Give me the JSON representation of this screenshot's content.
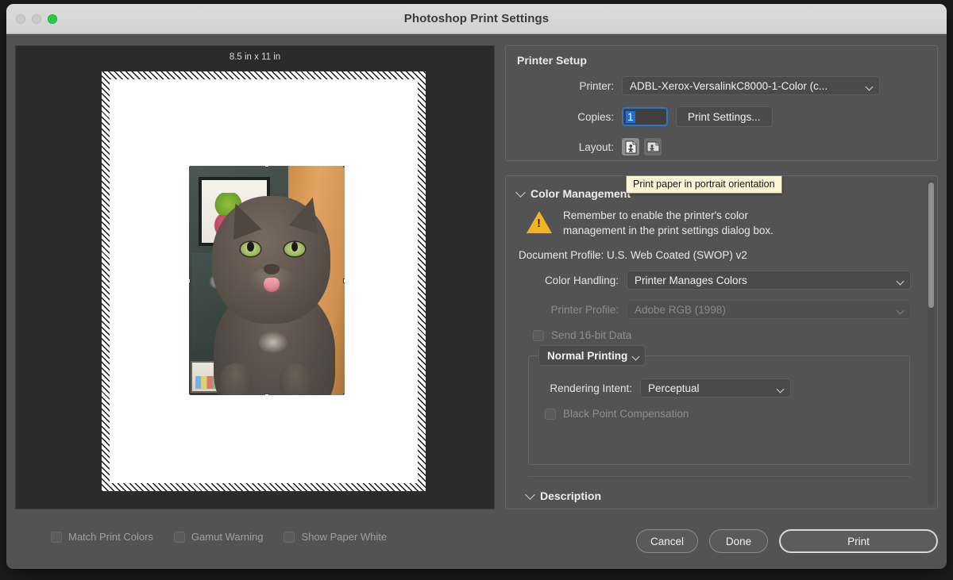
{
  "window": {
    "title": "Photoshop Print Settings",
    "traffic_lights": [
      "close",
      "minimize",
      "zoom"
    ]
  },
  "preview": {
    "page_size_label": "8.5 in x 11 in",
    "image_alt": "grey cat with tongue out",
    "proof_options": [
      {
        "label": "Match Print Colors",
        "checked": false,
        "enabled": false
      },
      {
        "label": "Gamut Warning",
        "checked": false,
        "enabled": false
      },
      {
        "label": "Show Paper White",
        "checked": false,
        "enabled": false
      }
    ]
  },
  "printer_setup": {
    "title": "Printer Setup",
    "printer_label": "Printer:",
    "printer_value": "ADBL-Xerox-VersalinkC8000-1-Color (c...",
    "copies_label": "Copies:",
    "copies_value": "1",
    "print_settings_label": "Print Settings...",
    "layout_label": "Layout:",
    "layout_portrait_selected": true
  },
  "tooltip": {
    "text": "Print paper in portrait orientation"
  },
  "color_management": {
    "title": "Color Management",
    "warning_text": "Remember to enable the printer's color management in the print settings dialog box.",
    "document_profile": "Document Profile: U.S. Web Coated (SWOP) v2",
    "color_handling_label": "Color Handling:",
    "color_handling_value": "Printer Manages Colors",
    "printer_profile_label": "Printer Profile:",
    "printer_profile_value": "Adobe RGB (1998)",
    "printer_profile_enabled": false,
    "send_16bit_label": "Send 16-bit Data",
    "send_16bit_enabled": false,
    "printing_mode": "Normal Printing",
    "rendering_intent_label": "Rendering Intent:",
    "rendering_intent_value": "Perceptual",
    "black_point_label": "Black Point Compensation",
    "black_point_enabled": false
  },
  "description": {
    "title": "Description"
  },
  "footer": {
    "cancel_label": "Cancel",
    "done_label": "Done",
    "print_label": "Print"
  },
  "colors": {
    "panel_bg": "#535353",
    "preview_bg": "#2b2b2b",
    "titlebar_bg": "#d6d6d6",
    "accent_blue": "#1f6fd4",
    "warning_yellow": "#f2b325",
    "tooltip_bg": "#fbf5d6"
  }
}
